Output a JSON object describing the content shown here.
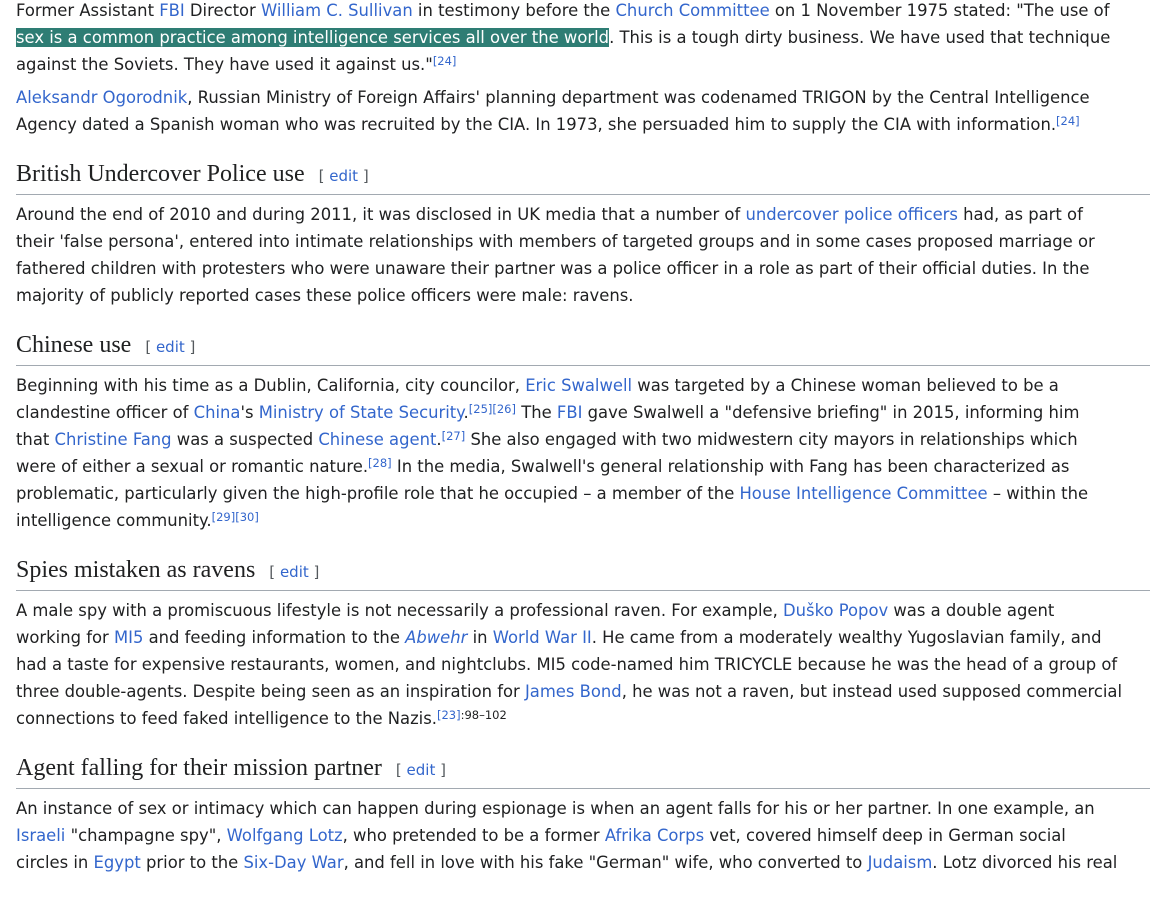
{
  "intro": {
    "p1": {
      "l1_t1": "Former Assistant ",
      "l1_a1": "FBI",
      "l1_t2": " Director ",
      "l1_a2": "William C. Sullivan",
      "l1_t3": " in testimony before the ",
      "l1_a3": "Church Committee",
      "l1_t4": " on 1 November 1975 stated: \"The use of",
      "l2_hl": "sex is a common practice among intelligence services all over the world",
      "l2_t1": ". This is a tough dirty business. We have used that technique",
      "l3_t1": "against the Soviets. They have used it against us.\"",
      "l3_ref": "[24]"
    },
    "p2": {
      "l1_a1": "Aleksandr Ogorodnik",
      "l1_t1": ", Russian Ministry of Foreign Affairs' planning department was codenamed TRIGON by the Central Intelligence",
      "l2_t1": "Agency dated a Spanish woman who was recruited by the CIA. In 1973, she persuaded him to supply the CIA with information.",
      "l2_ref": "[24]"
    }
  },
  "edit_bracket_open": "[",
  "edit_label": "edit",
  "edit_bracket_close": "]",
  "sections": {
    "british": {
      "heading": "British Undercover Police use",
      "l1_t1": "Around the end of 2010 and during 2011, it was disclosed in UK media that a number of ",
      "l1_a1": "undercover police officers",
      "l1_t2": " had, as part of",
      "l2_t1": "their 'false persona', entered into intimate relationships with members of targeted groups and in some cases proposed marriage or",
      "l3_t1": "fathered children with protesters who were unaware their partner was a police officer in a role as part of their official duties. In the",
      "l4_t1": "majority of publicly reported cases these police officers were male: ravens."
    },
    "chinese": {
      "heading": "Chinese use",
      "l1_t1": "Beginning with his time as a Dublin, California, city councilor, ",
      "l1_a1": "Eric Swalwell",
      "l1_t2": " was targeted by a Chinese woman believed to be a",
      "l2_t1": "clandestine officer of ",
      "l2_a1": "China",
      "l2_t2": "'s ",
      "l2_a2": "Ministry of State Security",
      "l2_t3": ".",
      "l2_ref1": "[25]",
      "l2_ref2": "[26]",
      "l2_t4": " The ",
      "l2_a3": "FBI",
      "l2_t5": " gave Swalwell a \"defensive briefing\" in 2015, informing him",
      "l3_t1": "that ",
      "l3_a1": "Christine Fang",
      "l3_t2": " was a suspected ",
      "l3_a2": "Chinese agent",
      "l3_t3": ".",
      "l3_ref1": "[27]",
      "l3_t4": " She also engaged with two midwestern city mayors in relationships which",
      "l4_t1": "were of either a sexual or romantic nature.",
      "l4_ref1": "[28]",
      "l4_t2": " In the media, Swalwell's general relationship with Fang has been characterized as",
      "l5_t1": "problematic, particularly given the high-profile role that he occupied – a member of the ",
      "l5_a1": "House Intelligence Committee",
      "l5_t2": " – within the",
      "l6_t1": "intelligence community.",
      "l6_ref1": "[29]",
      "l6_ref2": "[30]"
    },
    "spies": {
      "heading": "Spies mistaken as ravens",
      "l1_t1": "A male spy with a promiscuous lifestyle is not necessarily a professional raven. For example, ",
      "l1_a1": "Duško Popov",
      "l1_t2": " was a double agent",
      "l2_t1": "working for ",
      "l2_a1": "MI5",
      "l2_t2": " and feeding information to the ",
      "l2_a2": "Abwehr",
      "l2_t3": " in ",
      "l2_a3": "World War II",
      "l2_t4": ". He came from a moderately wealthy Yugoslavian family, and",
      "l3_t1": "had a taste for expensive restaurants, women, and nightclubs. MI5 code-named him TRICYCLE because he was the head of a group of",
      "l4_t1": "three double-agents. Despite being seen as an inspiration for ",
      "l4_a1": "James Bond",
      "l4_t2": ", he was not a raven, but instead used supposed commercial",
      "l5_t1": "connections to feed faked intelligence to the Nazis.",
      "l5_ref1": "[23]",
      "l5_pages": ":98–102"
    },
    "agent": {
      "heading": "Agent falling for their mission partner",
      "l1_t1": "An instance of sex or intimacy which can happen during espionage is when an agent falls for his or her partner. In one example, an",
      "l2_a1": "Israeli",
      "l2_t1": " \"champagne spy\", ",
      "l2_a2": "Wolfgang Lotz",
      "l2_t2": ", who pretended to be a former ",
      "l2_a3": "Afrika Corps",
      "l2_t3": " vet, covered himself deep in German social",
      "l3_t1": "circles in ",
      "l3_a1": "Egypt",
      "l3_t2": " prior to the ",
      "l3_a2": "Six-Day War",
      "l3_t3": ", and fell in love with his fake \"German\" wife, who converted to ",
      "l3_a3": "Judaism",
      "l3_t4": ". Lotz divorced his real"
    }
  }
}
